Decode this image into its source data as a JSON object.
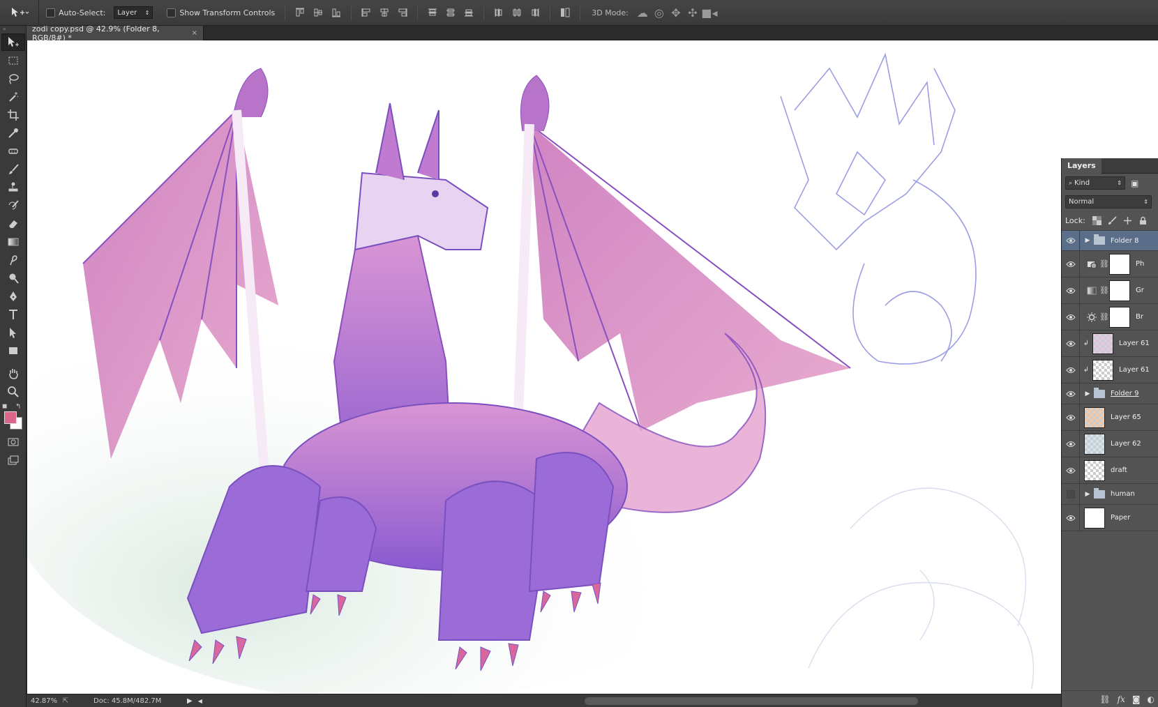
{
  "options_bar": {
    "auto_select_label": "Auto-Select:",
    "auto_select_value": "Layer",
    "transform_label": "Show Transform Controls",
    "mode3d_label": "3D Mode:"
  },
  "document": {
    "tab_title": "zodi copy.psd @ 42.9% (Folder 8, RGB/8#) *",
    "close_glyph": "×"
  },
  "colors": {
    "foreground": "#d8678a",
    "background": "#ffffff",
    "selection": "#5a6e8a"
  },
  "status_bar": {
    "zoom": "42.87%",
    "doc_size": "Doc: 45.8M/482.7M"
  },
  "layers_panel": {
    "tab_label": "Layers",
    "filter_value": "Kind",
    "blend_mode": "Normal",
    "lock_label": "Lock:",
    "layers": [
      {
        "name": "Folder 8",
        "type": "folder",
        "visible": true,
        "selected": true
      },
      {
        "name": "Ph",
        "type": "adjustment",
        "icon": "photo-filter-icon",
        "visible": true
      },
      {
        "name": "Gr",
        "type": "adjustment",
        "icon": "gradient-map-icon",
        "visible": true
      },
      {
        "name": "Br",
        "type": "adjustment",
        "icon": "brightness-icon",
        "visible": true
      },
      {
        "name": "Layer 61",
        "type": "layer",
        "clipped": true,
        "visible": true
      },
      {
        "name": "Layer 61",
        "type": "layer",
        "clipped": true,
        "visible": true
      },
      {
        "name": "Folder 9",
        "type": "folder",
        "visible": true
      },
      {
        "name": "Layer 65",
        "type": "layer",
        "visible": true
      },
      {
        "name": "Layer 62",
        "type": "layer",
        "visible": true
      },
      {
        "name": "draft",
        "type": "layer",
        "visible": true
      },
      {
        "name": "human",
        "type": "folder",
        "visible": false
      },
      {
        "name": "Paper",
        "type": "layer",
        "visible": true
      }
    ]
  }
}
